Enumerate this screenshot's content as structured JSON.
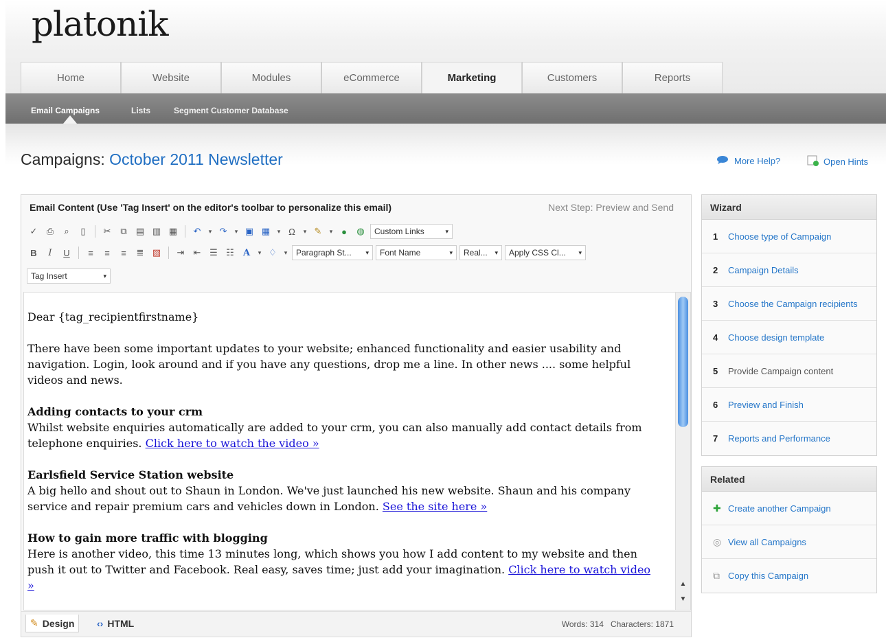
{
  "logo": "platonik",
  "main_tabs": [
    {
      "label": "Home",
      "active": false
    },
    {
      "label": "Website",
      "active": false
    },
    {
      "label": "Modules",
      "active": false
    },
    {
      "label": "eCommerce",
      "active": false
    },
    {
      "label": "Marketing",
      "active": true
    },
    {
      "label": "Customers",
      "active": false
    },
    {
      "label": "Reports",
      "active": false
    }
  ],
  "subnav": [
    "Email Campaigns",
    "Lists",
    "Segment Customer Database"
  ],
  "page": {
    "title_prefix": "Campaigns:",
    "campaign_name": "October 2011 Newsletter",
    "help_label": "More Help?",
    "hints_label": "Open Hints"
  },
  "editor": {
    "heading": "Email Content (Use 'Tag Insert' on the editor's toolbar to personalize this email)",
    "next_step": "Next Step: Preview and Send",
    "custom_links": "Custom Links",
    "paragraph_style": "Paragraph St...",
    "font_name": "Font Name",
    "font_size": "Real...",
    "apply_css": "Apply CSS Cl...",
    "tag_insert": "Tag Insert",
    "content": {
      "greeting": "Dear {tag_recipientfirstname}",
      "intro": "There have been some important updates to your website; enhanced functionality and easier usability and navigation. Login, look around and if you have any questions, drop me a line. In other news .... some helpful videos and news.",
      "s1_title": "Adding contacts to your crm",
      "s1_body": "Whilst website enquiries automatically are added to your crm, you can also manually add contact details from telephone enquiries.",
      "s1_link": "Click here to watch the video »",
      "s2_title": "Earlsfield Service Station website",
      "s2_body": "A big hello and shout out to Shaun in London. We've just launched his new website. Shaun and his company service and repair premium cars and vehicles down in London.",
      "s2_link": "See the site here »",
      "s3_title": "How to gain more traffic with blogging",
      "s3_body": "Here is another video, this time 13 minutes long, which shows you how I add content to my website and then push it out to Twitter and Facebook. Real easy, saves time; just add your imagination.",
      "s3_link": "Click here to watch video »"
    },
    "design_tab": "Design",
    "html_tab": "HTML",
    "words": "Words: 314",
    "characters": "Characters: 1871"
  },
  "wizard": {
    "title": "Wizard",
    "steps": [
      {
        "num": "1",
        "label": "Choose type of Campaign"
      },
      {
        "num": "2",
        "label": "Campaign Details"
      },
      {
        "num": "3",
        "label": "Choose the Campaign recipients"
      },
      {
        "num": "4",
        "label": "Choose design template"
      },
      {
        "num": "5",
        "label": "Provide Campaign content"
      },
      {
        "num": "6",
        "label": "Preview and Finish"
      },
      {
        "num": "7",
        "label": "Reports and Performance"
      }
    ]
  },
  "related": {
    "title": "Related",
    "items": [
      {
        "label": "Create another Campaign",
        "icon": "plus-icon"
      },
      {
        "label": "View all Campaigns",
        "icon": "list-icon"
      },
      {
        "label": "Copy this Campaign",
        "icon": "copy-icon"
      }
    ]
  }
}
